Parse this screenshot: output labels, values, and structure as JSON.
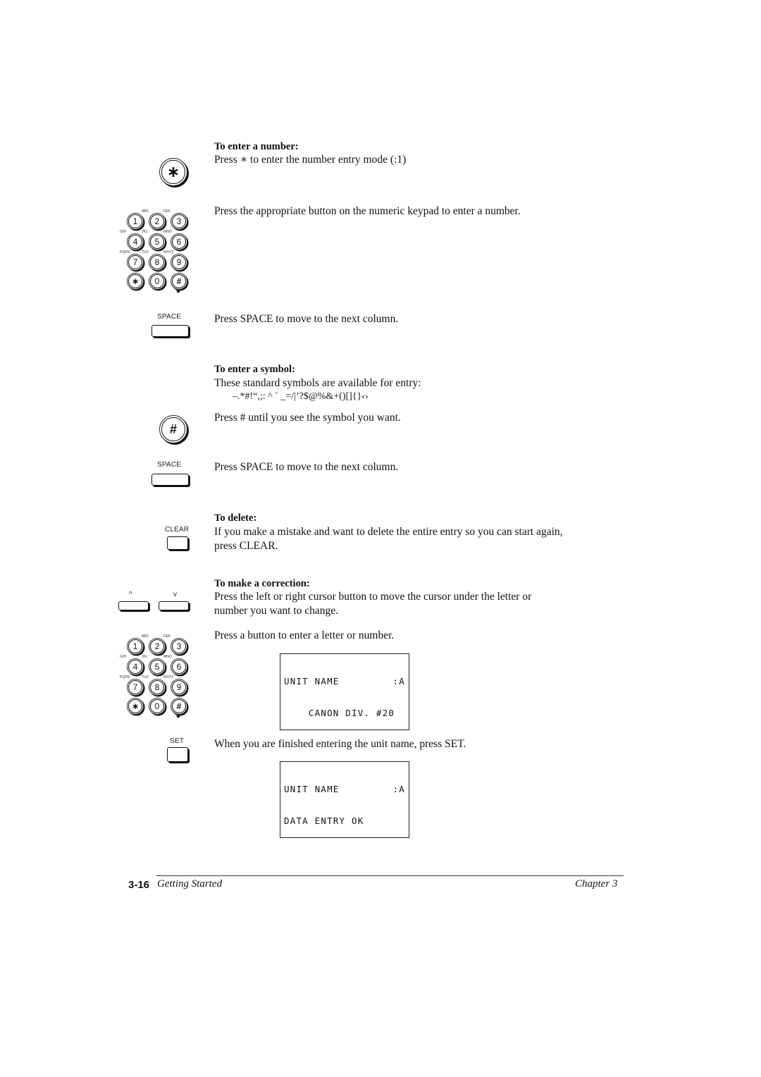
{
  "sections": {
    "number": {
      "heading": "To enter a number:",
      "step1": "Press ∗ to enter the number entry mode (:1)",
      "step2": "Press the appropriate button on the numeric keypad to enter a number.",
      "step3": "Press SPACE to move to the next column."
    },
    "symbol": {
      "heading": "To enter a symbol:",
      "intro": "These standard symbols are available for entry:",
      "symbols": "–.*#!“,;: ^ ` _=/|’?$@%&+()[]{}‹›",
      "step1": "Press # until you see the symbol you want.",
      "step2": "Press SPACE to move to the next column."
    },
    "delete": {
      "heading": "To delete:",
      "line1": "If you make a mistake and want to delete the entire entry so you can start again,",
      "line2": "press CLEAR."
    },
    "correction": {
      "heading": "To make a correction:",
      "line1": "Press the left or right cursor button to move the cursor under the letter or",
      "line2": "number you want to change.",
      "step2": "Press a button to enter a letter or number.",
      "step3": "When you are finished entering the unit name, press SET."
    }
  },
  "keys": {
    "star": "∗",
    "hash": "#",
    "space": "SPACE",
    "clear": "CLEAR",
    "set": "SET",
    "cursor_left": "^",
    "cursor_right": "v",
    "keypad": [
      {
        "digit": "1",
        "letters": ""
      },
      {
        "digit": "2",
        "letters": "ABC"
      },
      {
        "digit": "3",
        "letters": "DEF"
      },
      {
        "digit": "4",
        "letters": "GHI"
      },
      {
        "digit": "5",
        "letters": "JKL"
      },
      {
        "digit": "6",
        "letters": "MNO"
      },
      {
        "digit": "7",
        "letters": "PQRS"
      },
      {
        "digit": "8",
        "letters": "TUV"
      },
      {
        "digit": "9",
        "letters": "WXYZ"
      },
      {
        "digit": "∗",
        "letters": ""
      },
      {
        "digit": "0",
        "letters": ""
      },
      {
        "digit": "#",
        "letters": ""
      }
    ]
  },
  "displays": {
    "lcd1": {
      "line1_left": "UNIT NAME",
      "line1_right": ":A",
      "line2": "    CANON DIV. #20"
    },
    "lcd2": {
      "line1_left": "UNIT NAME",
      "line1_right": ":A",
      "line2": "DATA ENTRY OK"
    }
  },
  "footer": {
    "page_number": "3-16",
    "section_title": "Getting Started",
    "chapter": "Chapter 3"
  }
}
